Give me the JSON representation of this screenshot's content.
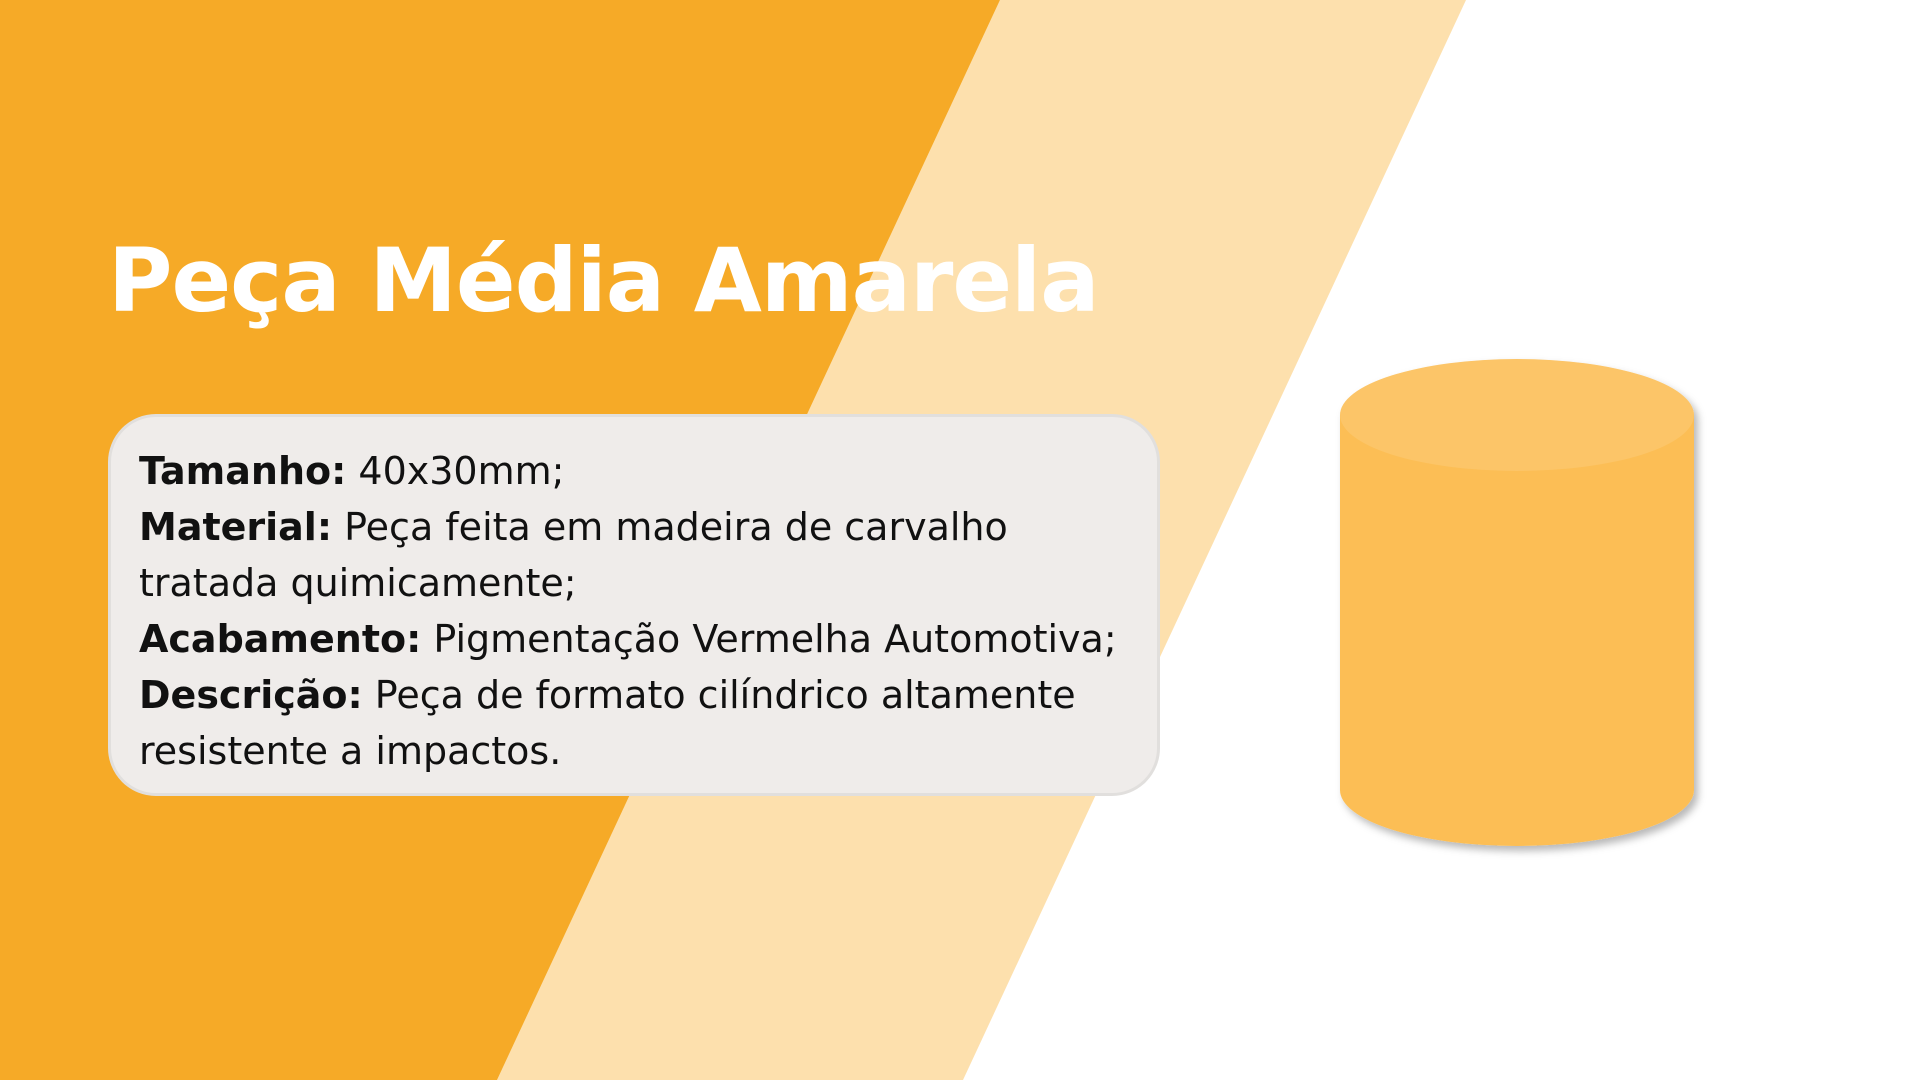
{
  "slide": {
    "title": "Peça Média Amarela",
    "colors": {
      "primary_orange": "#f6aa27",
      "light_band": "#fde0ad",
      "cylinder_fill": "#fcbe55",
      "cylinder_top": "#fcc567",
      "card_bg": "#efecea",
      "title_text": "#ffffff"
    },
    "details": [
      {
        "label": "Tamanho:",
        "value": " 40x30mm;"
      },
      {
        "label": "Material:",
        "value": " Peça feita em madeira de carvalho tratada quimicamente;"
      },
      {
        "label": "Acabamento:",
        "value": " Pigmentação Vermelha Automotiva;"
      },
      {
        "label": "Descrição:",
        "value": " Peça de formato cilíndrico altamente resistente a impactos."
      }
    ],
    "illustration": "cylinder-icon"
  }
}
